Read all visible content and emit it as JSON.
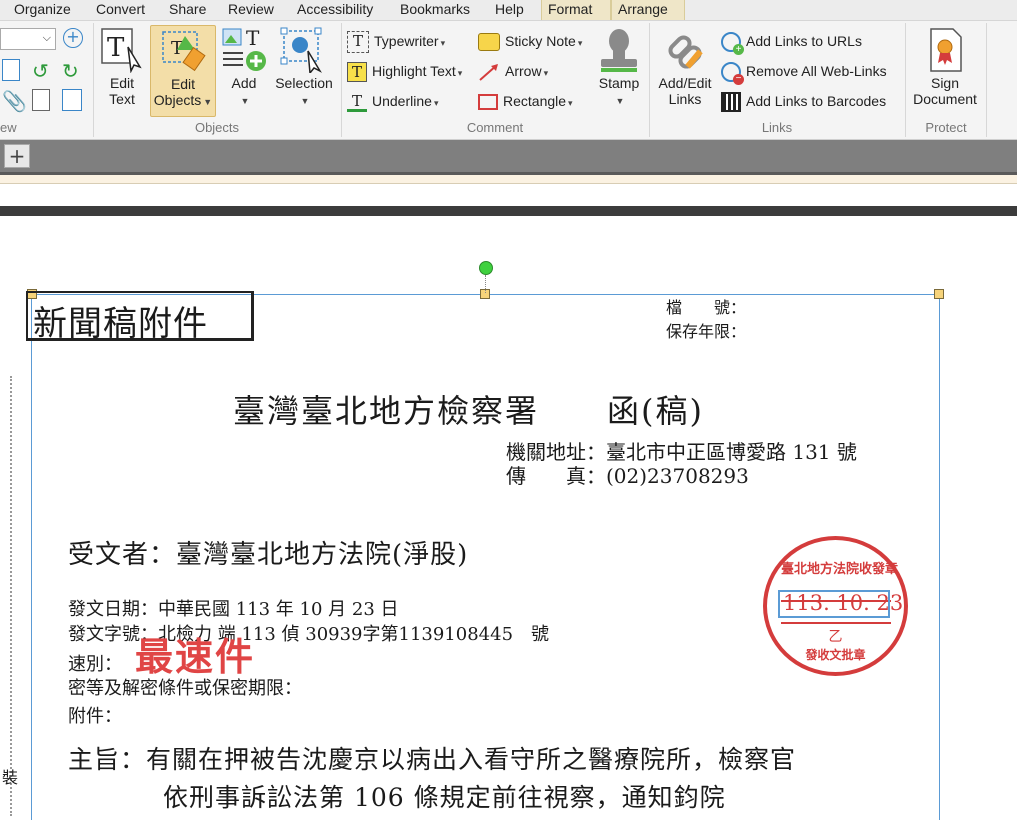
{
  "menu": {
    "items": [
      "Organize",
      "Convert",
      "Share",
      "Review",
      "Accessibility",
      "Bookmarks",
      "Help",
      "Format",
      "Arrange"
    ]
  },
  "ribbon": {
    "view_group_label": "ew",
    "objects": {
      "edit_text_label_1": "Edit",
      "edit_text_label_2": "Text",
      "edit_objects_label_1": "Edit",
      "edit_objects_label_2": "Objects",
      "add_label": "Add",
      "selection_label": "Selection",
      "group_label": "Objects"
    },
    "comment": {
      "typewriter": "Typewriter",
      "highlight_text": "Highlight Text",
      "underline": "Underline",
      "sticky_note": "Sticky Note",
      "arrow": "Arrow",
      "rectangle": "Rectangle",
      "stamp": "Stamp",
      "group_label": "Comment"
    },
    "links": {
      "add_edit_links_1": "Add/Edit",
      "add_edit_links_2": "Links",
      "add_links_to_urls": "Add Links to URLs",
      "remove_all_web_links": "Remove All Web-Links",
      "add_links_to_barcodes": "Add Links to Barcodes",
      "group_label": "Links"
    },
    "protect": {
      "sign_document_1": "Sign",
      "sign_document_2": "Document",
      "group_label": "Protect"
    }
  },
  "tabs": {
    "new_tab": "+"
  },
  "document": {
    "header_title": "新聞稿附件",
    "file_no_label": "檔　　號：",
    "retention_label": "保存年限：",
    "main_title": "臺灣臺北地方檢察署　　函(稿)",
    "address": "機關地址：臺北市中正區博愛路 131 號",
    "fax": "傳　　真：(02)23708293",
    "recipient": "受文者：臺灣臺北地方法院(淨股)",
    "issue_date": "發文日期：中華民國 113 年 10 月 23 日",
    "issue_no": "發文字號：北檢力 端 113 偵 30939字第1139108445　號",
    "speed": "速別：",
    "speed_stamp": "最速件",
    "secrecy": "密等及解密條件或保密期限：",
    "attachment": "附件：",
    "subject_line1": "主旨：有關在押被告沈慶京以病出入看守所之醫療院所，檢察官",
    "subject_line2": "依刑事訴訟法第 106 條規定前往視察，通知鈞院",
    "stamp_top": "臺北地方法院收發章",
    "stamp_date": "113. 10. 23",
    "stamp_bottom": "乙",
    "stamp_bottom2": "發收文批章",
    "side_char": "裝"
  },
  "colors": {
    "accent_blue": "#5b9bd5",
    "stamp_red": "#d43c3c",
    "selected_btn": "#f3dea8"
  }
}
